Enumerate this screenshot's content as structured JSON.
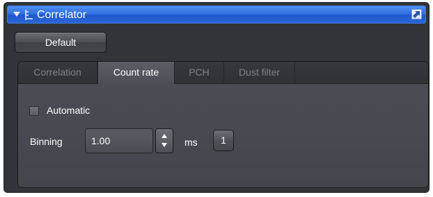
{
  "titlebar": {
    "title": "Correlator",
    "collapse_icon": "triangle-down-icon",
    "tree_icon": "tree-icon",
    "expand_icon": "expand-icon",
    "accent": "#2d6be0"
  },
  "toolbar": {
    "default_label": "Default"
  },
  "tabs": [
    {
      "label": "Correlation",
      "active": false
    },
    {
      "label": "Count rate",
      "active": true
    },
    {
      "label": "PCH",
      "active": false
    },
    {
      "label": "Dust filter",
      "active": false
    }
  ],
  "count_rate": {
    "automatic_label": "Automatic",
    "automatic_checked": false,
    "binning_label": "Binning",
    "binning_value": "1.00",
    "unit_label": "ms",
    "multiplier_label": "1"
  }
}
